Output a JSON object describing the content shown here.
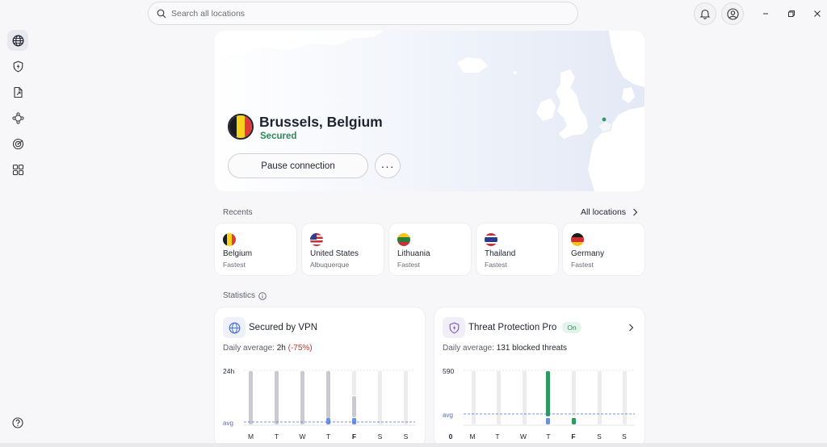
{
  "search": {
    "placeholder": "Search all locations"
  },
  "header": {
    "notifications_icon": "bell-icon",
    "account_icon": "user-circle-icon"
  },
  "sidebar": {
    "items": [
      {
        "icon": "globe-icon",
        "active": true
      },
      {
        "icon": "shield-lightning-icon",
        "active": false
      },
      {
        "icon": "file-arrow-icon",
        "active": false
      },
      {
        "icon": "mesh-network-icon",
        "active": false
      },
      {
        "icon": "radar-icon",
        "active": false
      },
      {
        "icon": "apps-grid-icon",
        "active": false
      }
    ],
    "help_icon": "help-circle-icon"
  },
  "connection": {
    "location": "Brussels, Belgium",
    "status": "Secured",
    "pause_label": "Pause connection",
    "more_label": "···"
  },
  "recents": {
    "label": "Recents",
    "all_locations_label": "All locations",
    "items": [
      {
        "name": "Belgium",
        "sub": "Fastest"
      },
      {
        "name": "United States",
        "sub": "Albuquerque"
      },
      {
        "name": "Lithuania",
        "sub": "Fastest"
      },
      {
        "name": "Thailand",
        "sub": "Fastest"
      },
      {
        "name": "Germany",
        "sub": "Fastest"
      }
    ]
  },
  "statistics": {
    "label": "Statistics",
    "vpn": {
      "title": "Secured by VPN",
      "sub_label": "Daily average:",
      "sub_value": "2h",
      "sub_change": "(-75%)",
      "y_top_label": "24h",
      "avg_label": "avg",
      "days": [
        "M",
        "T",
        "W",
        "T",
        "F",
        "S",
        "S"
      ]
    },
    "threat": {
      "title": "Threat Protection Pro",
      "badge": "On",
      "sub_label": "Daily average:",
      "sub_value": "131 blocked threats",
      "y_top_label": "590",
      "y_zero_label": "0",
      "avg_label": "avg",
      "days": [
        "M",
        "T",
        "W",
        "T",
        "F",
        "S",
        "S"
      ]
    }
  },
  "colors": {
    "secured_green": "#2b8a55",
    "avg_blue": "#4a6fd8",
    "bar_gray": "#c9cacf",
    "bar_green": "#2e9a62",
    "negative_red": "#c0392b"
  }
}
